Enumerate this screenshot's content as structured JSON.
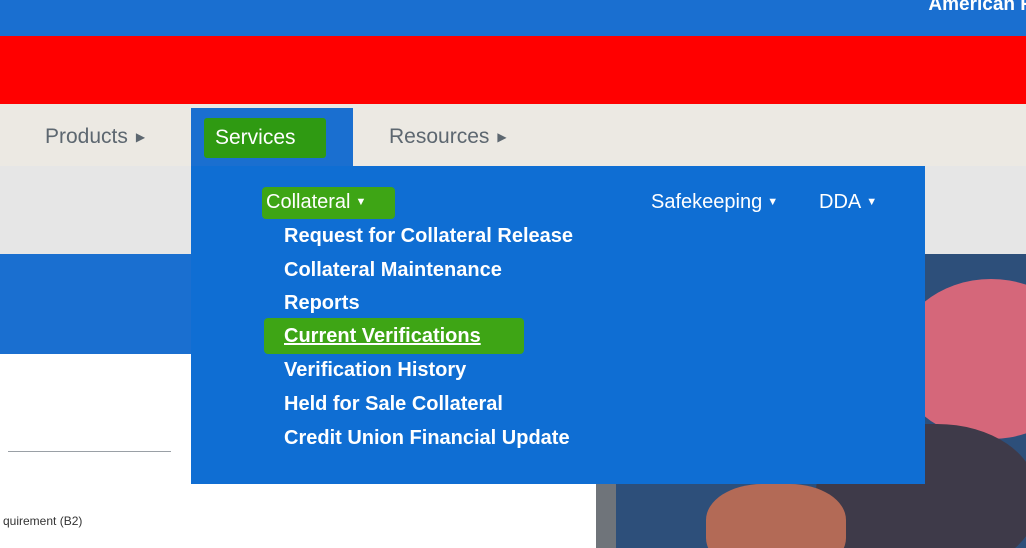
{
  "header": {
    "brand": "American R"
  },
  "nav": {
    "products": "Products",
    "services": "Services",
    "resources": "Resources"
  },
  "dropdown": {
    "collateral": "Collateral",
    "safekeeping": "Safekeeping",
    "dda": "DDA",
    "collateral_items": [
      "Request for Collateral Release",
      "Collateral Maintenance",
      "Reports",
      "Current Verifications",
      "Verification History",
      "Held for Sale Collateral",
      "Credit Union Financial Update"
    ]
  },
  "body": {
    "requirement_text": "quirement (B2)"
  },
  "colors": {
    "nav_blue": "#1a6fd0",
    "red_banner": "#ff0000",
    "highlight_green": "#3ea515"
  }
}
